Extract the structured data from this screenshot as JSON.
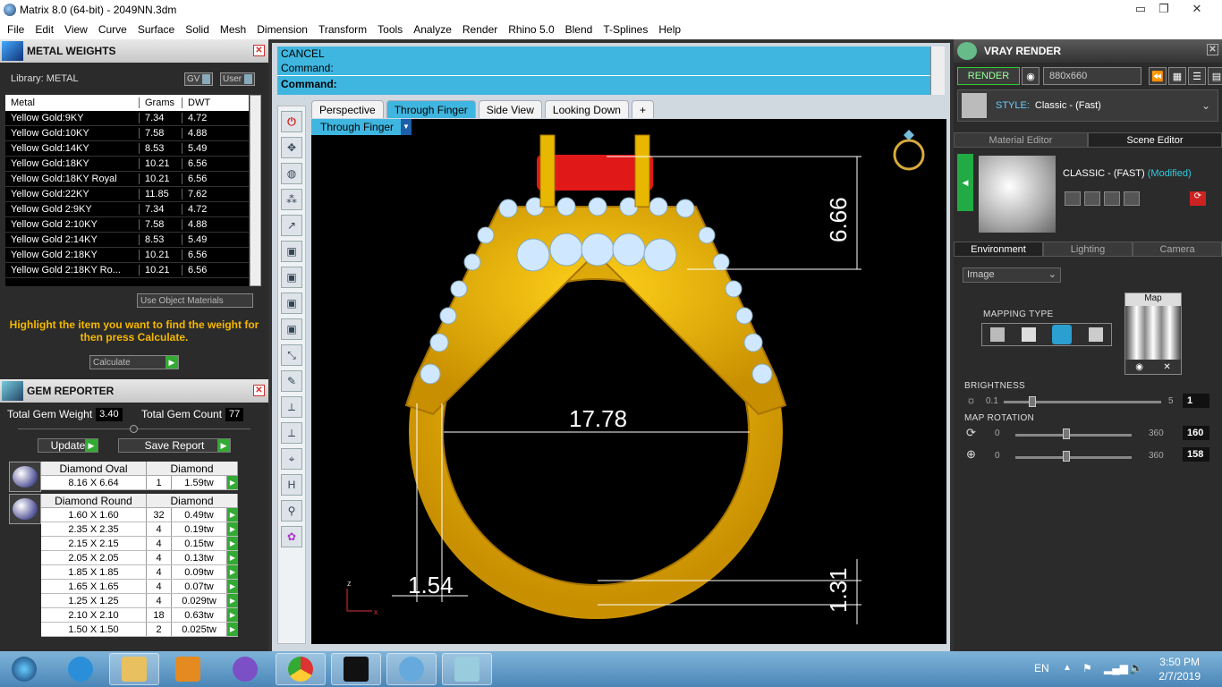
{
  "window": {
    "title": "Matrix 8.0 (64-bit) - 2049NN.3dm",
    "controls": [
      "▭",
      "❐",
      "✕"
    ]
  },
  "menu": [
    "File",
    "Edit",
    "View",
    "Curve",
    "Surface",
    "Solid",
    "Mesh",
    "Dimension",
    "Transform",
    "Tools",
    "Analyze",
    "Render",
    "Rhino 5.0",
    "Blend",
    "T-Splines",
    "Help"
  ],
  "metal_weights": {
    "title": "METAL WEIGHTS",
    "library": "Library: METAL",
    "gv": "GV",
    "user": "User",
    "columns": [
      "Metal",
      "Grams",
      "DWT"
    ],
    "rows": [
      [
        "Yellow Gold:9KY",
        "7.34",
        "4.72"
      ],
      [
        "Yellow Gold:10KY",
        "7.58",
        "4.88"
      ],
      [
        "Yellow Gold:14KY",
        "8.53",
        "5.49"
      ],
      [
        "Yellow Gold:18KY",
        "10.21",
        "6.56"
      ],
      [
        "Yellow Gold:18KY Royal",
        "10.21",
        "6.56"
      ],
      [
        "Yellow Gold:22KY",
        "11.85",
        "7.62"
      ],
      [
        "Yellow Gold 2:9KY",
        "7.34",
        "4.72"
      ],
      [
        "Yellow Gold 2:10KY",
        "7.58",
        "4.88"
      ],
      [
        "Yellow Gold 2:14KY",
        "8.53",
        "5.49"
      ],
      [
        "Yellow Gold 2:18KY",
        "10.21",
        "6.56"
      ],
      [
        "Yellow Gold 2:18KY Ro...",
        "10.21",
        "6.56"
      ]
    ],
    "use_object_materials": "Use Object Materials",
    "hint": "Highlight the item you want to find the weight for then press Calculate.",
    "calculate": "Calculate"
  },
  "gem_reporter": {
    "title": "GEM REPORTER",
    "total_weight_label": "Total Gem Weight",
    "total_weight": "3.40",
    "total_count_label": "Total Gem Count",
    "total_count": "77",
    "update": "Update",
    "save_report": "Save Report",
    "oval": {
      "name": "Diamond Oval",
      "material": "Diamond",
      "rows": [
        [
          "8.16 X 6.64",
          "1",
          "1.59tw"
        ]
      ]
    },
    "round": {
      "name": "Diamond Round",
      "material": "Diamond",
      "rows": [
        [
          "1.60 X 1.60",
          "32",
          "0.49tw"
        ],
        [
          "2.35 X 2.35",
          "4",
          "0.19tw"
        ],
        [
          "2.15 X 2.15",
          "4",
          "0.15tw"
        ],
        [
          "2.05 X 2.05",
          "4",
          "0.13tw"
        ],
        [
          "1.85 X 1.85",
          "4",
          "0.09tw"
        ],
        [
          "1.65 X 1.65",
          "4",
          "0.07tw"
        ],
        [
          "1.25 X 1.25",
          "4",
          "0.029tw"
        ],
        [
          "2.10 X 2.10",
          "18",
          "0.63tw"
        ],
        [
          "1.50 X 1.50",
          "2",
          "0.025tw"
        ]
      ]
    }
  },
  "command": {
    "line1": "CANCEL",
    "line2": "Command:",
    "line3": "Command:"
  },
  "tabs": [
    "Perspective",
    "Through Finger",
    "Side View",
    "Looking Down",
    "+"
  ],
  "active_view": "Through Finger",
  "dims": {
    "top": "6.66",
    "width": "17.78",
    "side": "1.54",
    "bottom": "1.31"
  },
  "axes": {
    "z": "z",
    "x": "x"
  },
  "vray": {
    "title": "VRAY RENDER",
    "render": "RENDER",
    "resolution": "880x660",
    "style_label": "STYLE:",
    "style_value": "Classic - (Fast)",
    "tab_material": "Material Editor",
    "tab_scene": "Scene Editor",
    "preset": "CLASSIC - (FAST)",
    "modified": "(Modified)",
    "env_tabs": [
      "Environment",
      "Lighting",
      "Camera"
    ],
    "env_type": "Image",
    "map_label": "Map",
    "mapping_type": "MAPPING TYPE",
    "brightness": {
      "label": "BRIGHTNESS",
      "min": "0.1",
      "max": "5",
      "value": "1"
    },
    "map_rotation": {
      "label": "MAP ROTATION",
      "min": "0",
      "max": "360",
      "h": "160",
      "v": "158"
    }
  },
  "taskbar": {
    "lang": "EN",
    "time": "3:50 PM",
    "date": "2/7/2019"
  }
}
